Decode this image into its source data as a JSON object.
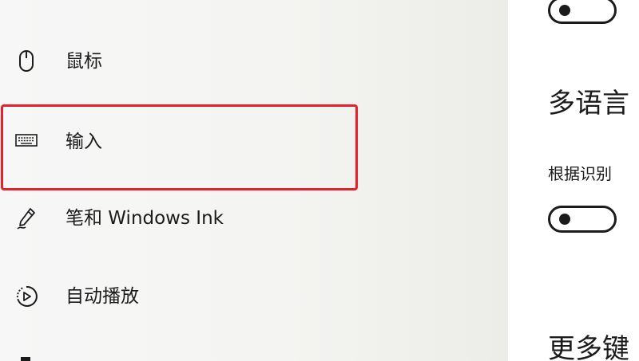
{
  "sidebar": {
    "items": [
      {
        "icon": "mouse-icon",
        "label": "鼠标"
      },
      {
        "icon": "keyboard-icon",
        "label": "输入"
      },
      {
        "icon": "pen-icon",
        "label": "笔和 Windows Ink"
      },
      {
        "icon": "autoplay-icon",
        "label": "自动播放"
      }
    ],
    "selected": "输入"
  },
  "content": {
    "top_toggle": {
      "state": "off"
    },
    "multilingual": {
      "title": "多语言",
      "option_text": "根据识别",
      "toggle": {
        "state": "off"
      }
    },
    "more": {
      "title": "更多键"
    }
  },
  "colors": {
    "highlight": "#e8202a",
    "text": "#1b1b1b"
  }
}
